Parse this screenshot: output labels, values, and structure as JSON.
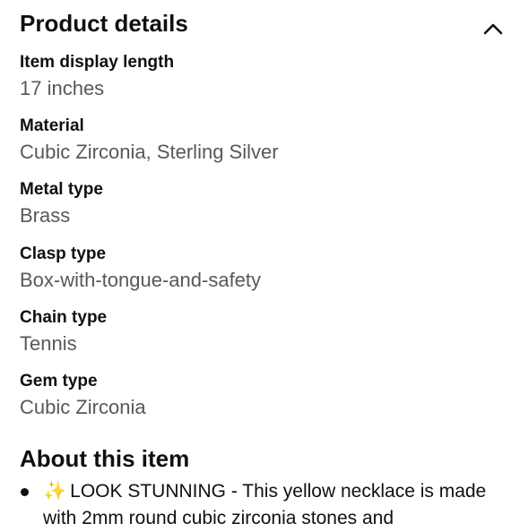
{
  "product_details": {
    "title": "Product details",
    "rows": [
      {
        "label": "Item display length",
        "value": "17 inches"
      },
      {
        "label": "Material",
        "value": "Cubic Zirconia, Sterling Silver"
      },
      {
        "label": "Metal type",
        "value": "Brass"
      },
      {
        "label": "Clasp type",
        "value": "Box-with-tongue-and-safety"
      },
      {
        "label": "Chain type",
        "value": "Tennis"
      },
      {
        "label": "Gem type",
        "value": "Cubic Zirconia"
      }
    ]
  },
  "about": {
    "title": "About this item",
    "bullets": [
      {
        "icon": "sparkle-icon",
        "icon_glyph": "✨",
        "text": "LOOK STUNNING - This yellow necklace is made with 2mm round cubic zirconia stones and"
      }
    ]
  }
}
